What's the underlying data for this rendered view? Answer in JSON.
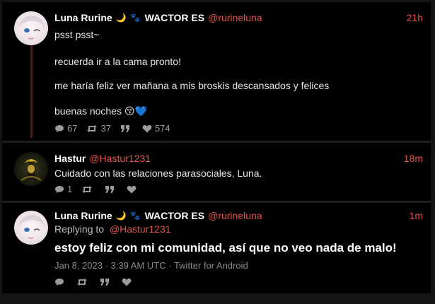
{
  "tweets": [
    {
      "name": "Luna Rurine",
      "badge": "WACTOR ES",
      "handle": "@rurineluna",
      "time": "21h",
      "lines": [
        "psst psst~",
        "recuerda ir a la cama pronto!",
        "me haría feliz ver mañana a mis broskis descansados y felices",
        "buenas noches 😚💙"
      ],
      "replies": "67",
      "retweets": "37",
      "likes": "574"
    },
    {
      "name": "Hastur",
      "handle": "@Hastur1231",
      "time": "18m",
      "text": "Cuidado con las relaciones parasociales, Luna.",
      "replies": "1"
    },
    {
      "name": "Luna Rurine",
      "badge": "WACTOR ES",
      "handle": "@rurineluna",
      "time": "1m",
      "replying_label": "Replying to",
      "replying_handle": "@Hastur1231",
      "text": "estoy feliz con mi comunidad, así que no veo nada de malo!",
      "date": "Jan 8, 2023",
      "clock": "3:39 AM UTC",
      "source": "Twitter for Android",
      "sep": "·"
    }
  ],
  "colors": {
    "accent": "#e1544c",
    "background": "#000000",
    "thread": "#5a1414"
  },
  "icons": [
    "moon-icon",
    "paws-icon",
    "reply-icon",
    "retweet-icon",
    "quote-icon",
    "heart-icon"
  ]
}
